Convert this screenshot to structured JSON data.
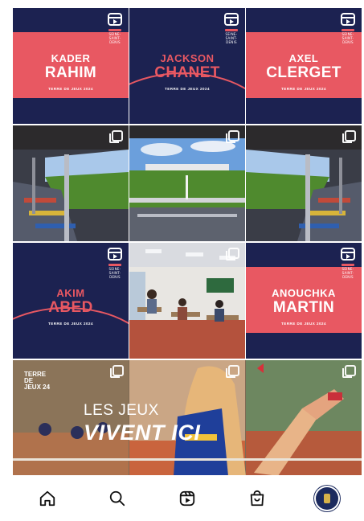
{
  "grid": {
    "posters": [
      {
        "first": "KADER",
        "last": "RAHIM",
        "tagline": "TERRE DE JEUX 2024",
        "logo": "SEINE-SAINT-DENIS"
      },
      {
        "first": "JACKSON",
        "last": "CHANET",
        "tagline": "TERRE DE JEUX 2024",
        "logo": "SEINE-SAINT-DENIS"
      },
      {
        "first": "AXEL",
        "last": "CLERGET",
        "tagline": "TERRE DE JEUX 2024",
        "logo": "SEINE-SAINT-DENIS"
      },
      {
        "first": "AKIM",
        "last": "ABED",
        "tagline": "TERRE DE JEUX 2024",
        "logo": "SEINE-SAINT-DENIS"
      },
      {
        "first": "ANOUCHKA",
        "last": "MARTIN",
        "tagline": "TERRE DE JEUX 2024",
        "logo": "SEINE-SAINT-DENIS"
      }
    ],
    "banner": {
      "line1": "LES JEUX",
      "line2": "VIVENT ICI",
      "corner_logo": "TERRE DE JEUX 24"
    }
  },
  "colors": {
    "navy": "#1c2251",
    "coral": "#e85862",
    "grass": "#4f8a2e",
    "sky": "#8fb6e0"
  },
  "nav": {
    "items": [
      "home-icon",
      "search-icon",
      "reels-icon",
      "shop-icon",
      "profile-avatar"
    ]
  }
}
